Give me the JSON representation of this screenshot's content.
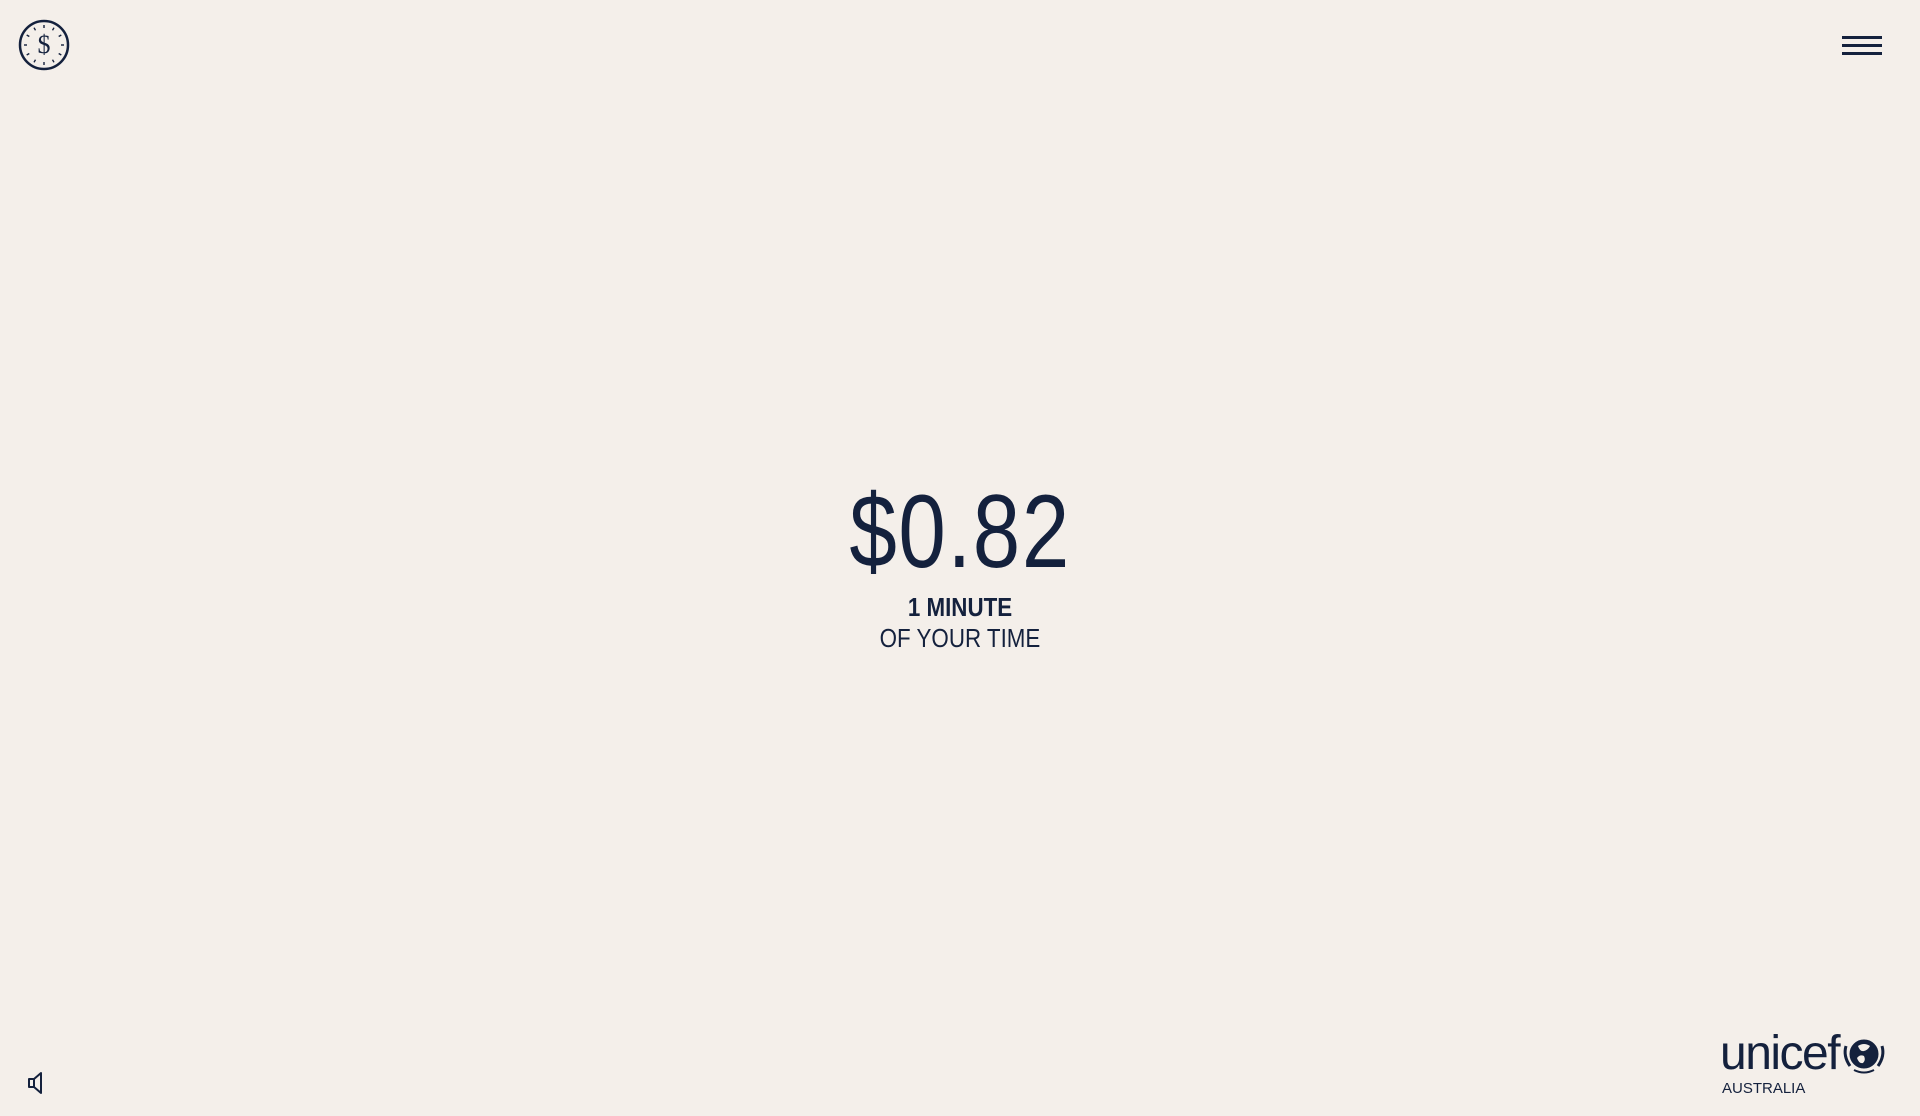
{
  "header": {
    "logo_icon": "clock-dollar-icon",
    "menu_icon": "hamburger-menu-icon"
  },
  "main": {
    "amount": "$0.82",
    "duration": "1 MINUTE",
    "caption": "OF YOUR TIME"
  },
  "footer": {
    "sound_icon": "speaker-muted-icon",
    "brand": {
      "name": "unicef",
      "country": "AUSTRALIA",
      "emblem_icon": "unicef-emblem-icon"
    }
  },
  "colors": {
    "background": "#f4efea",
    "ink": "#14213d"
  }
}
